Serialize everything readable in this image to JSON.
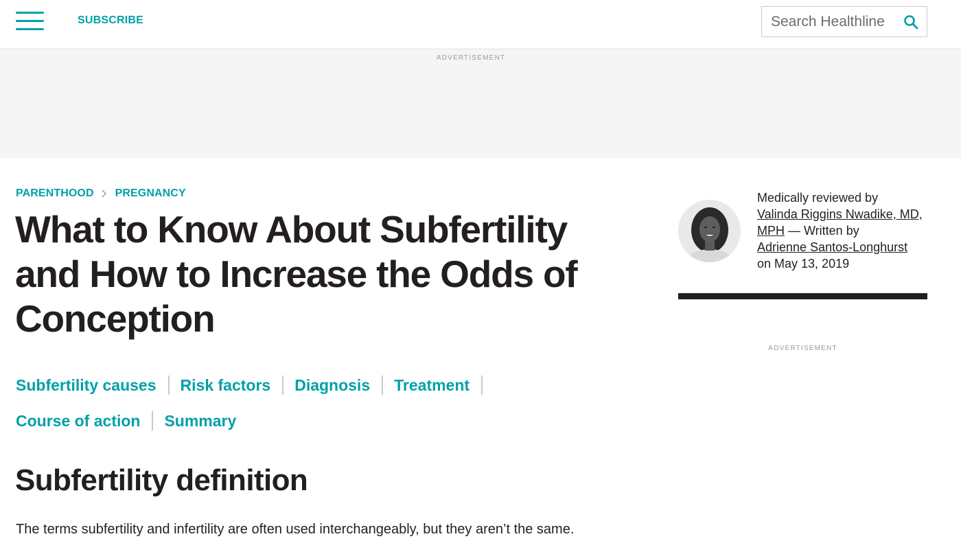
{
  "header": {
    "menu_icon": "hamburger-menu-icon",
    "subscribe_label": "SUBSCRIBE",
    "search": {
      "placeholder": "Search Healthline",
      "value": "",
      "icon": "search-icon"
    }
  },
  "ads": {
    "top_label": "ADVERTISEMENT",
    "sidebar_label": "ADVERTISEMENT"
  },
  "breadcrumb": {
    "items": [
      "PARENTHOOD",
      "PREGNANCY"
    ],
    "separator_icon": "chevron-right-icon"
  },
  "article": {
    "title": "What to Know About Subfertility and How to Increase the Odds of Conception",
    "jumplinks": [
      "Subfertility causes",
      "Risk factors",
      "Diagnosis",
      "Treatment",
      "Course of action",
      "Summary"
    ],
    "section_heading": "Subfertility definition",
    "first_paragraph": "The terms subfertility and infertility are often used interchangeably, but they aren’t the same."
  },
  "byline": {
    "reviewed_prefix": "Medically reviewed by",
    "reviewer": "Valinda Riggins Nwadike, MD, MPH",
    "written_prefix": "— Written by",
    "author": "Adrienne Santos-Longhurst",
    "date_text": "on May 13, 2019",
    "avatar_icon": "reviewer-avatar"
  },
  "colors": {
    "accent": "#00a0a8",
    "text": "#231f20",
    "ad_background": "#f5f5f5"
  }
}
